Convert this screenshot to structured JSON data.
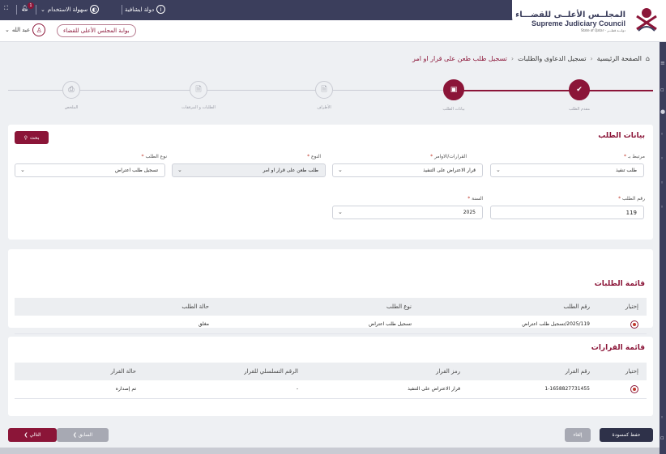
{
  "topbar": {
    "lang": "دولة ايشافية",
    "accessibility": "سهولة الاستخدام",
    "notifications_count": "1"
  },
  "header": {
    "logo_ar": "المجلــس الأعلــى للقضـــاء",
    "logo_en": "Supreme Judiciary Council",
    "logo_sub": "State of Qatar - دولـــة قطـــر",
    "portal_label": "بوابة المجلس الأعلى للقضاء",
    "user_name": "عبد الله"
  },
  "breadcrumb": {
    "home": "الصفحة الرئيسية",
    "section": "تسجيل الدعاوى والطلبات",
    "current": "تسجيل طلب طعن على قرار او امر"
  },
  "stepper": {
    "steps": [
      {
        "label": "مقدم الطلب",
        "state": "done",
        "icon": "check-icon"
      },
      {
        "label": "بيانات الطلب",
        "state": "active",
        "icon": "case-icon"
      },
      {
        "label": "الأطراف",
        "state": "pending",
        "icon": "document-icon"
      },
      {
        "label": "الطلبات و المرفقات",
        "state": "pending",
        "icon": "document-icon"
      },
      {
        "label": "الملخص",
        "state": "pending",
        "icon": "printer-icon"
      }
    ]
  },
  "request_data": {
    "title": "بيانات الطلب",
    "search_label": "بحث",
    "linked_label": "مرتبط بـ",
    "linked_value": "طلب تنفيذ",
    "decisions_label": "القرارات/الاوامر",
    "decisions_value": "قرار الاعتراض على التنفيذ",
    "type_label": "النوع",
    "type_value": "طلب طعن على قرار او امر",
    "request_type_label": "نوع الطلب",
    "request_type_value": "تسجيل طلب اعتراض",
    "request_number_label": "رقم الطلب",
    "request_number_value": "119",
    "year_label": "السنة",
    "year_value": "2025"
  },
  "requests_list": {
    "title": "قائمة الطلبات",
    "columns": [
      "إختيار",
      "رقم الطلب",
      "نوع الطلب",
      "حالة الطلب"
    ],
    "rows": [
      {
        "number": "2025/119/تسجيل طلب اعتراض",
        "type": "تسجيل طلب اعتراض",
        "status": "مغلق"
      }
    ]
  },
  "decisions_list": {
    "title": "قائمة القرارات",
    "columns": [
      "إختيار",
      "رقم القرار",
      "رمز القرار",
      "الرقم التسلسلي للقرار",
      "حالة القرار"
    ],
    "rows": [
      {
        "number": "1-1658827731455",
        "code": "قرار الاعتراض على التنفيذ",
        "serial": "-",
        "status": "تم إصداره"
      }
    ]
  },
  "footer": {
    "next": "التالي",
    "prev": "السابق",
    "save_draft": "حفظ كمسودة",
    "cancel": "إلغاء"
  },
  "colors": {
    "brand": "#8b1538",
    "dark": "#3b3e5c"
  }
}
